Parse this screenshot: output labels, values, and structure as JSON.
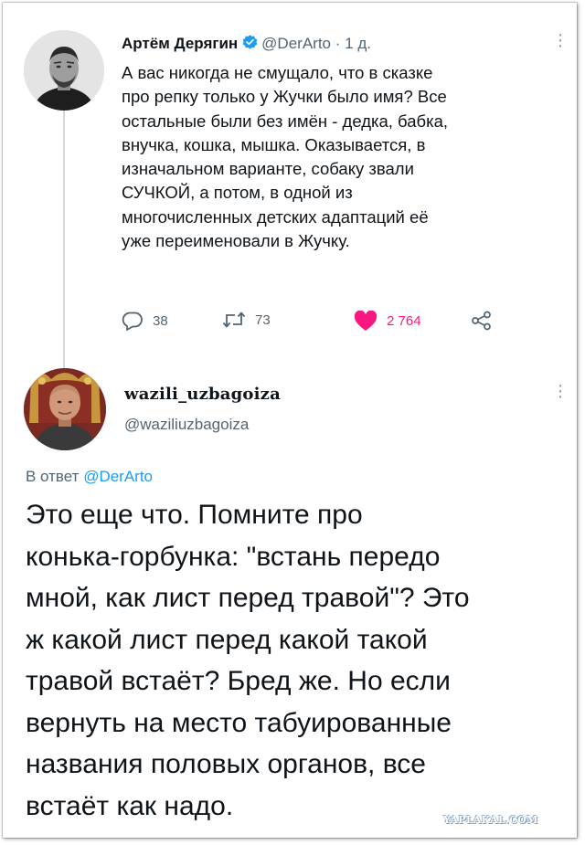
{
  "tweet1": {
    "author_name": "Артём Дерягин",
    "handle": "@DerArto",
    "separator": "·",
    "time": "1 д.",
    "lines": [
      "А вас никогда не смущало, что в сказке",
      "про репку только у Жучки было имя? Все",
      "остальные были без имён - дедка, бабка,",
      "внучка, кошка, мышка. Оказывается, в",
      "изначальном варианте, собаку звали",
      "СУЧКОЙ, а потом, в одной из",
      "многочисленных детских адаптаций её",
      "уже переименовали в Жучку."
    ],
    "replies": "38",
    "retweets": "73",
    "likes": "2 764",
    "avatar_icon": "man-portrait-avatar",
    "verified_icon": "verified-badge-icon"
  },
  "tweet2": {
    "author_name": "wazili_uzbagoiza",
    "handle": "@waziliuzbagoiza",
    "reply_prefix": "В ответ",
    "reply_mention": "@DerArto",
    "lines": [
      "Это еще что. Помните про",
      "конька-горбунка: \"встань передо",
      "мной, как лист перед травой\"? Это",
      "ж какой лист перед какой такой",
      "травой встаёт? Бред же. Но если",
      "вернуть на место табуированные",
      "названия половых органов, все",
      "встаёт как надо."
    ],
    "avatar_icon": "man-throne-avatar"
  },
  "watermark": "YAPLAKAL.COM",
  "colors": {
    "text": "#0f1419",
    "secondary": "#536471",
    "link": "#1d9bf0",
    "like": "#f91880",
    "thread_line": "#cfd9de"
  }
}
